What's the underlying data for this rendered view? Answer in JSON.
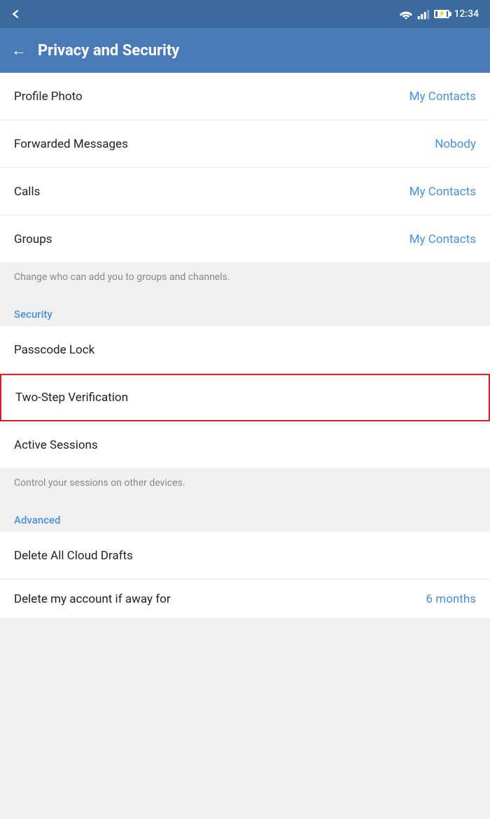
{
  "statusBar": {
    "time": "12:34"
  },
  "appBar": {
    "title": "Privacy and Security",
    "backLabel": "←"
  },
  "privacySection": {
    "items": [
      {
        "label": "Profile Photo",
        "value": "My Contacts"
      },
      {
        "label": "Forwarded Messages",
        "value": "Nobody"
      },
      {
        "label": "Calls",
        "value": "My Contacts"
      },
      {
        "label": "Groups",
        "value": "My Contacts"
      }
    ],
    "groupsDescription": "Change who can add you to groups and channels."
  },
  "securitySection": {
    "header": "Security",
    "items": [
      {
        "label": "Passcode Lock",
        "value": ""
      },
      {
        "label": "Two-Step Verification",
        "value": "",
        "highlighted": true
      },
      {
        "label": "Active Sessions",
        "value": ""
      }
    ],
    "activeSessionsDescription": "Control your sessions on other devices."
  },
  "advancedSection": {
    "header": "Advanced",
    "items": [
      {
        "label": "Delete All Cloud Drafts",
        "value": ""
      },
      {
        "label": "Delete my account if away for",
        "value": "6 months",
        "partial": true
      }
    ]
  }
}
